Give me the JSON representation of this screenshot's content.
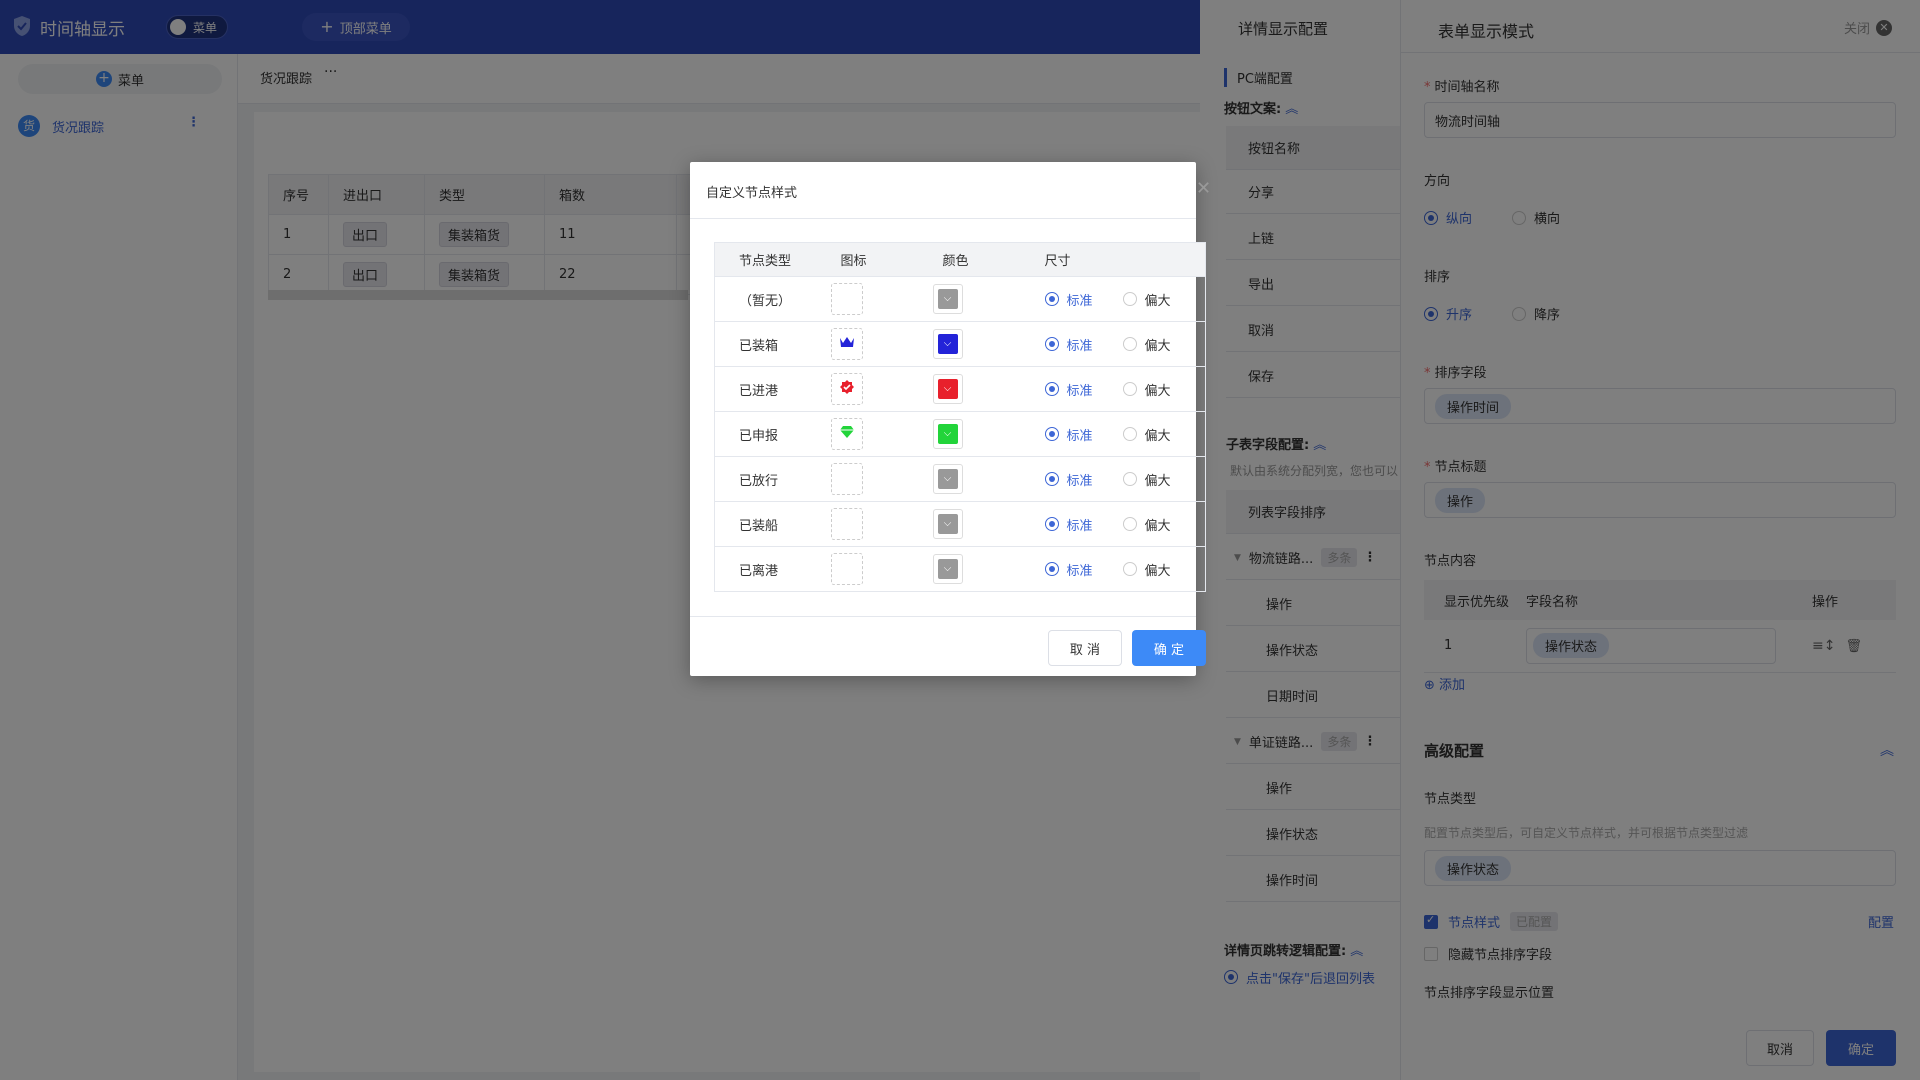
{
  "app": {
    "title": "时间轴显示",
    "menu_toggle_label": "菜单",
    "top_menu_label": "顶部菜单"
  },
  "sidebar": {
    "add_menu_label": "菜单",
    "items": [
      {
        "badge": "货",
        "label": "货况跟踪"
      }
    ]
  },
  "content": {
    "title": "货况跟踪",
    "more": "···",
    "table": {
      "columns": [
        "序号",
        "进出口",
        "类型",
        "箱数",
        ""
      ],
      "rows": [
        {
          "index": "1",
          "io": "出口",
          "type": "集装箱货",
          "count": "11"
        },
        {
          "index": "2",
          "io": "出口",
          "type": "集装箱货",
          "count": "22"
        }
      ]
    }
  },
  "detail_drawer": {
    "title": "详情显示配置",
    "pc_section": "PC端配置",
    "button_text_label": "按钮文案:",
    "button_name_header": "按钮名称",
    "buttons": [
      "分享",
      "上链",
      "导出",
      "取消",
      "保存"
    ],
    "subtable_label": "子表字段配置:",
    "subtable_note": "默认由系统分配列宽，您也可以",
    "list_sort_header": "列表字段排序",
    "groups": [
      {
        "name": "物流链路...",
        "tag": "多条",
        "fields": [
          "操作",
          "操作状态",
          "日期时间"
        ]
      },
      {
        "name": "单证链路...",
        "tag": "多条",
        "fields": [
          "操作",
          "操作状态",
          "操作时间"
        ]
      }
    ],
    "jump_label": "详情页跳转逻辑配置:",
    "jump_option": "点击\"保存\"后退回列表"
  },
  "form_drawer": {
    "title": "表单显示模式",
    "close_label": "关闭",
    "name_label": "时间轴名称",
    "name_value": "物流时间轴",
    "direction_label": "方向",
    "direction_options": [
      "纵向",
      "横向"
    ],
    "direction_selected": "纵向",
    "sort_label": "排序",
    "sort_options": [
      "升序",
      "降序"
    ],
    "sort_selected": "升序",
    "sort_field_label": "排序字段",
    "sort_field_value": "操作时间",
    "node_title_label": "节点标题",
    "node_title_value": "操作",
    "node_content_label": "节点内容",
    "content_table": {
      "headers": [
        "显示优先级",
        "字段名称",
        "操作"
      ],
      "rows": [
        {
          "priority": "1",
          "field": "操作状态"
        }
      ]
    },
    "add_label": "添加",
    "advanced_title": "高级配置",
    "node_type_label": "节点类型",
    "node_type_hint": "配置节点类型后，可自定义节点样式，并可根据节点类型过滤",
    "node_type_value": "操作状态",
    "node_style_label": "节点样式",
    "node_style_tag": "已配置",
    "configure_link": "配置",
    "hide_sort_label": "隐藏节点排序字段",
    "sort_position_label": "节点排序字段显示位置",
    "cancel_label": "取消",
    "ok_label": "确定"
  },
  "modal": {
    "title": "自定义节点样式",
    "headers": [
      "节点类型",
      "图标",
      "颜色",
      "尺寸"
    ],
    "size_options": [
      "标准",
      "偏大"
    ],
    "rows": [
      {
        "type": "（暂无）",
        "icon": "circle-icon",
        "color": "#999999",
        "size": "标准"
      },
      {
        "type": "已装箱",
        "icon": "crown-icon",
        "color": "#2323d8",
        "size": "标准"
      },
      {
        "type": "已进港",
        "icon": "badge-icon",
        "color": "#e8202c",
        "size": "标准"
      },
      {
        "type": "已申报",
        "icon": "diamond-icon",
        "color": "#22d43a",
        "size": "标准"
      },
      {
        "type": "已放行",
        "icon": "circle-icon",
        "color": "#999999",
        "size": "标准"
      },
      {
        "type": "已装船",
        "icon": "circle-icon",
        "color": "#999999",
        "size": "标准"
      },
      {
        "type": "已离港",
        "icon": "circle-icon",
        "color": "#999999",
        "size": "标准"
      }
    ],
    "cancel_label": "取 消",
    "ok_label": "确 定"
  }
}
